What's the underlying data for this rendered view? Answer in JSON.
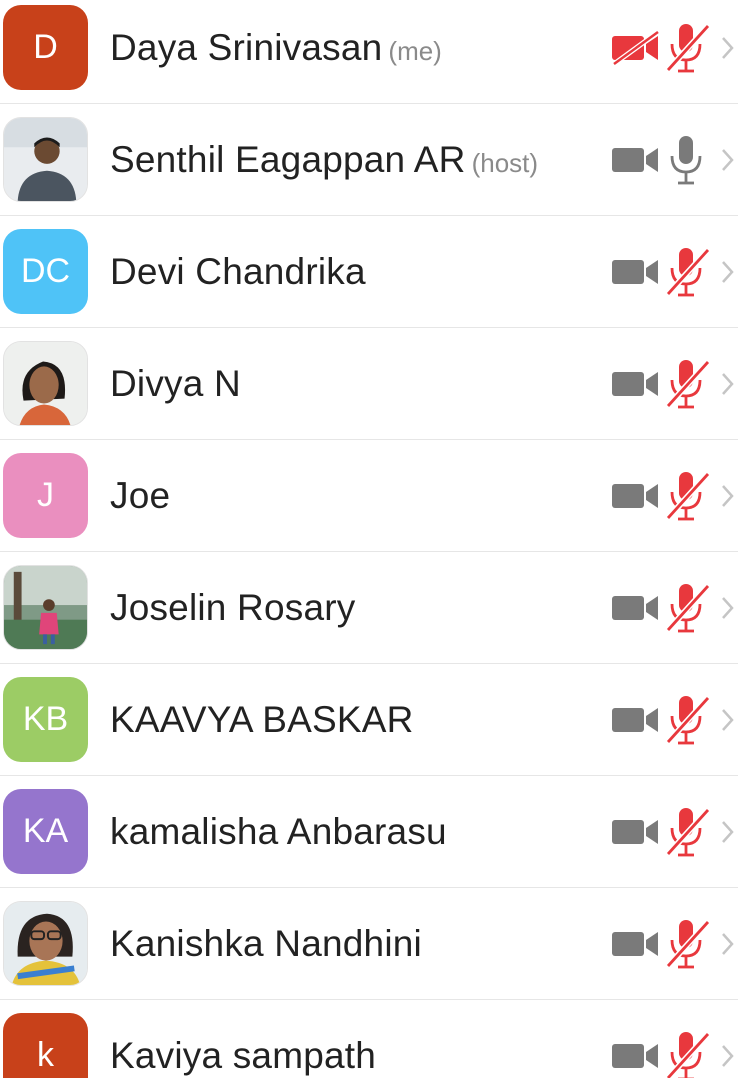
{
  "colors": {
    "muted_red": "#e8383d",
    "icon_gray": "#7a7a7a",
    "chevron": "#c5c5c5",
    "divider": "#e6e6e6"
  },
  "participants": [
    {
      "name": "Daya Srinivasan",
      "tag": "(me)",
      "avatar_type": "initials",
      "initials": "D",
      "avatar_color": "#c8411a",
      "video_off_icon": "video-off-icon",
      "mic_icon": "mic-muted-icon"
    },
    {
      "name": "Senthil Eagappan AR",
      "tag": "(host)",
      "avatar_type": "photo",
      "initials": "",
      "avatar_color": "",
      "video_icon": "video-camera-icon",
      "mic_icon": "microphone-icon"
    },
    {
      "name": "Devi Chandrika",
      "tag": "",
      "avatar_type": "initials",
      "initials": "DC",
      "avatar_color": "#4fc3f7",
      "video_icon": "video-camera-icon",
      "mic_icon": "mic-muted-icon"
    },
    {
      "name": "Divya N",
      "tag": "",
      "avatar_type": "photo",
      "initials": "",
      "avatar_color": "",
      "video_icon": "video-camera-icon",
      "mic_icon": "mic-muted-icon"
    },
    {
      "name": "Joe",
      "tag": "",
      "avatar_type": "initials",
      "initials": "J",
      "avatar_color": "#ea8fbf",
      "video_icon": "video-camera-icon",
      "mic_icon": "mic-muted-icon"
    },
    {
      "name": "Joselin Rosary",
      "tag": "",
      "avatar_type": "photo",
      "initials": "",
      "avatar_color": "",
      "video_icon": "video-camera-icon",
      "mic_icon": "mic-muted-icon"
    },
    {
      "name": "KAAVYA BASKAR",
      "tag": "",
      "avatar_type": "initials",
      "initials": "KB",
      "avatar_color": "#9ccc65",
      "video_icon": "video-camera-icon",
      "mic_icon": "mic-muted-icon"
    },
    {
      "name": "kamalisha Anbarasu",
      "tag": "",
      "avatar_type": "initials",
      "initials": "KA",
      "avatar_color": "#9575cd",
      "video_icon": "video-camera-icon",
      "mic_icon": "mic-muted-icon"
    },
    {
      "name": "Kanishka Nandhini",
      "tag": "",
      "avatar_type": "photo",
      "initials": "",
      "avatar_color": "",
      "video_icon": "video-camera-icon",
      "mic_icon": "mic-muted-icon"
    },
    {
      "name": "Kaviya sampath",
      "tag": "",
      "avatar_type": "initials",
      "initials": "k",
      "avatar_color": "#c8411a",
      "video_icon": "video-camera-icon",
      "mic_icon": "mic-muted-icon"
    }
  ]
}
